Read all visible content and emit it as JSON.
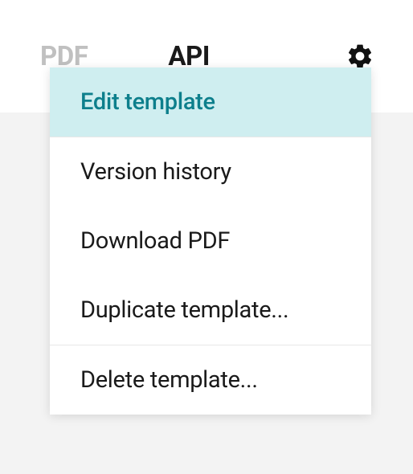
{
  "tabs": {
    "pdf": "PDF",
    "api": "API"
  },
  "icons": {
    "gear": "gear-icon"
  },
  "menu": {
    "items": [
      {
        "label": "Edit template",
        "highlighted": true
      },
      {
        "label": "Version history",
        "highlighted": false
      },
      {
        "label": "Download PDF",
        "highlighted": false
      },
      {
        "label": "Duplicate template...",
        "highlighted": false
      },
      {
        "label": "Delete template...",
        "highlighted": false
      }
    ]
  }
}
